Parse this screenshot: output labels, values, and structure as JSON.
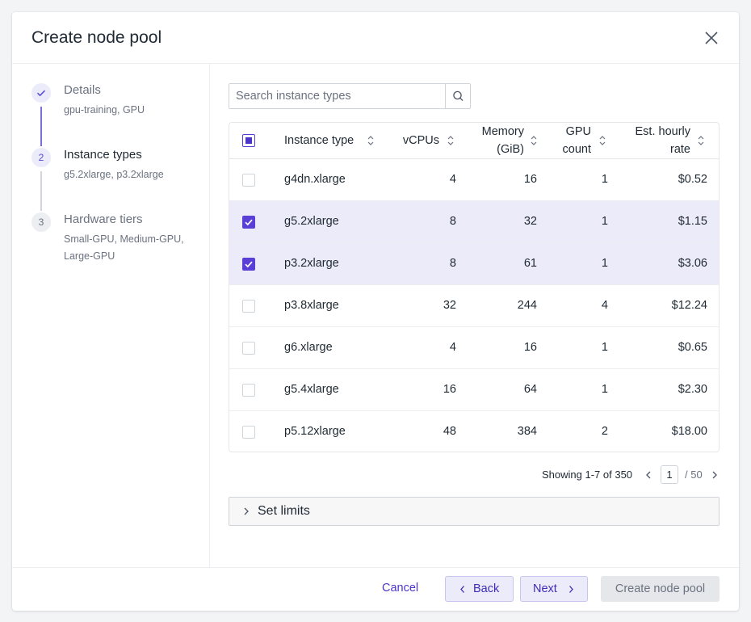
{
  "modal": {
    "title": "Create node pool",
    "close_icon": "close-icon"
  },
  "wizard": {
    "steps": [
      {
        "marker": "",
        "icon": "check-icon",
        "title": "Details",
        "summary": "gpu-training, GPU",
        "state": "complete"
      },
      {
        "marker": "2",
        "title": "Instance types",
        "summary": "g5.2xlarge, p3.2xlarge",
        "state": "current"
      },
      {
        "marker": "3",
        "title": "Hardware tiers",
        "summary": "Small-GPU, Medium-GPU, Large-GPU",
        "state": "upcoming"
      }
    ]
  },
  "search": {
    "placeholder": "Search instance types",
    "value": "",
    "icon": "search-icon"
  },
  "table": {
    "select_all_state": "indeterminate",
    "columns": [
      {
        "line1": "",
        "line2": "Instance type"
      },
      {
        "line1": "",
        "line2": "vCPUs"
      },
      {
        "line1": "Memory",
        "line2": "(GiB)"
      },
      {
        "line1": "GPU",
        "line2": "count"
      },
      {
        "line1": "Est. hourly",
        "line2": "rate"
      }
    ],
    "sort_icon": "sort-icon",
    "rows": [
      {
        "type": "g4dn.xlarge",
        "vcpus": "4",
        "memory": "16",
        "gpu": "1",
        "rate": "$0.52",
        "selected": false
      },
      {
        "type": "g5.2xlarge",
        "vcpus": "8",
        "memory": "32",
        "gpu": "1",
        "rate": "$1.15",
        "selected": true
      },
      {
        "type": "p3.2xlarge",
        "vcpus": "8",
        "memory": "61",
        "gpu": "1",
        "rate": "$3.06",
        "selected": true
      },
      {
        "type": "p3.8xlarge",
        "vcpus": "32",
        "memory": "244",
        "gpu": "4",
        "rate": "$12.24",
        "selected": false
      },
      {
        "type": "g6.xlarge",
        "vcpus": "4",
        "memory": "16",
        "gpu": "1",
        "rate": "$0.65",
        "selected": false
      },
      {
        "type": "g5.4xlarge",
        "vcpus": "16",
        "memory": "64",
        "gpu": "1",
        "rate": "$2.30",
        "selected": false
      },
      {
        "type": "p5.12xlarge",
        "vcpus": "48",
        "memory": "384",
        "gpu": "2",
        "rate": "$18.00",
        "selected": false
      }
    ]
  },
  "pagination": {
    "showing": "Showing 1-7 of 350",
    "current_page": "1",
    "total": "/ 50"
  },
  "limits": {
    "label": "Set limits"
  },
  "footer": {
    "cancel": "Cancel",
    "back": "Back",
    "next": "Next",
    "create": "Create node pool"
  },
  "colors": {
    "accent": "#5a3fd6",
    "selected_row": "#ecebfa",
    "text": "#1f2933",
    "muted": "#6b7280"
  }
}
